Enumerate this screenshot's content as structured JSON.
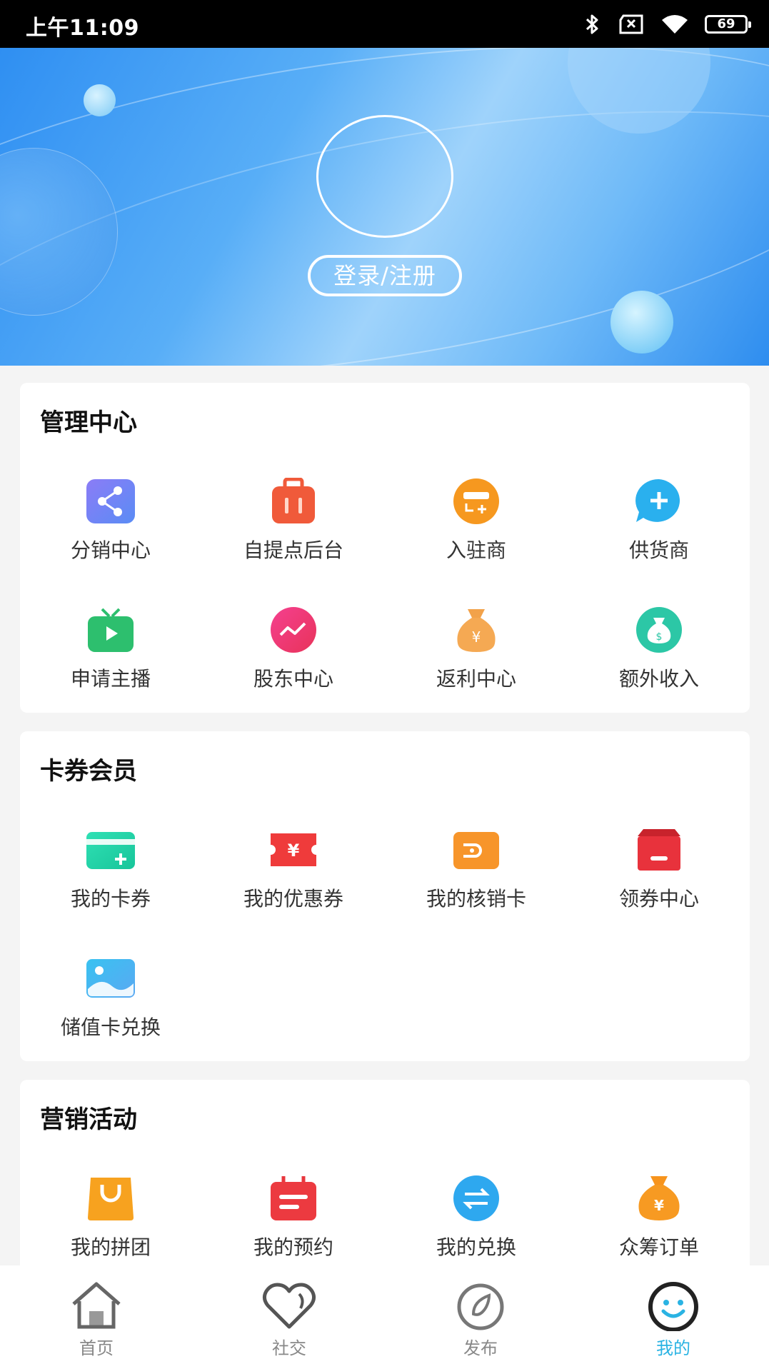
{
  "status_bar": {
    "time": "上午11:09",
    "battery": "69"
  },
  "header": {
    "login_label": "登录/注册"
  },
  "sections": [
    {
      "title": "管理中心",
      "items": [
        {
          "label": "分销中心",
          "icon": "share-icon"
        },
        {
          "label": "自提点后台",
          "icon": "bag-icon"
        },
        {
          "label": "入驻商",
          "icon": "card-plus-icon"
        },
        {
          "label": "供货商",
          "icon": "chat-plus-icon"
        },
        {
          "label": "申请主播",
          "icon": "tv-play-icon"
        },
        {
          "label": "股东中心",
          "icon": "trend-icon"
        },
        {
          "label": "返利中心",
          "icon": "money-bag-icon"
        },
        {
          "label": "额外收入",
          "icon": "dollar-bag-icon"
        }
      ]
    },
    {
      "title": "卡券会员",
      "items": [
        {
          "label": "我的卡券",
          "icon": "card-icon"
        },
        {
          "label": "我的优惠券",
          "icon": "coupon-icon"
        },
        {
          "label": "我的核销卡",
          "icon": "wallet-icon"
        },
        {
          "label": "领券中心",
          "icon": "store-icon"
        },
        {
          "label": "储值卡兑换",
          "icon": "image-card-icon"
        }
      ]
    },
    {
      "title": "营销活动",
      "items": [
        {
          "label": "我的拼团",
          "icon": "shopping-bag-icon"
        },
        {
          "label": "我的预约",
          "icon": "calendar-icon"
        },
        {
          "label": "我的兑换",
          "icon": "exchange-icon"
        },
        {
          "label": "众筹订单",
          "icon": "yen-bag-icon"
        }
      ]
    }
  ],
  "bottom_nav": [
    {
      "label": "首页",
      "icon": "home-icon"
    },
    {
      "label": "社交",
      "icon": "heart-icon"
    },
    {
      "label": "发布",
      "icon": "publish-icon"
    },
    {
      "label": "我的",
      "icon": "smile-icon",
      "active": true
    }
  ],
  "colors": {
    "accent": "#2ab3e3"
  }
}
